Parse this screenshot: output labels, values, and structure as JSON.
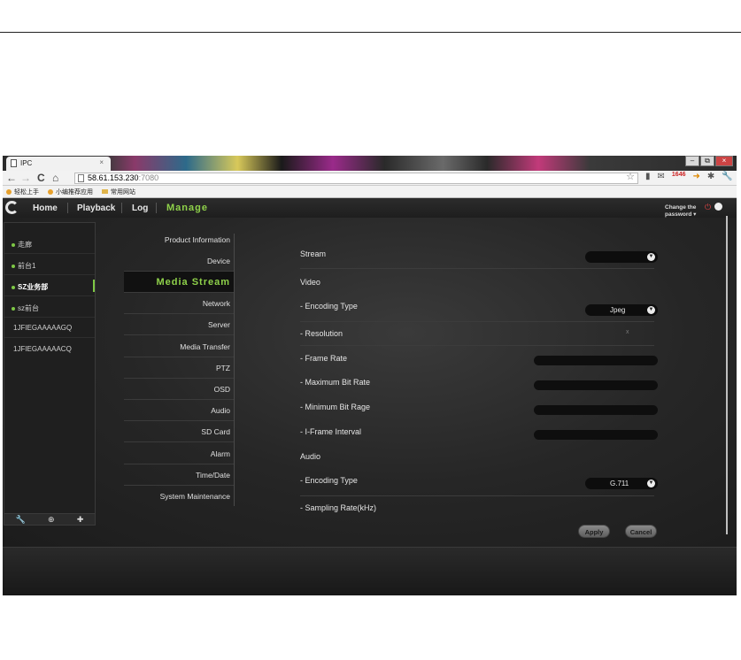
{
  "browser": {
    "tab_title": "IPC",
    "tab_close": "×",
    "url_host": "58.61.153.230",
    "url_port": ":7080",
    "window_controls": [
      "–",
      "⧉",
      "×"
    ],
    "badge": "1646"
  },
  "bookmarks": [
    {
      "label": "轻松上手",
      "icon": "chrome-icon"
    },
    {
      "label": "小编推荐应用",
      "icon": "chrome-icon"
    },
    {
      "label": "常用网站",
      "icon": "folder-icon"
    }
  ],
  "header": {
    "home": "Home",
    "playback": "Playback",
    "log": "Log",
    "manage": "Manage",
    "change_password_1": "Change the",
    "change_password_2": "password ▾"
  },
  "devices": [
    {
      "label": "走廊",
      "dot": true,
      "active": false
    },
    {
      "label": "前台1",
      "dot": true,
      "active": false
    },
    {
      "label": "SZ业务部",
      "dot": true,
      "active": true
    },
    {
      "label": "sz前台",
      "dot": true,
      "active": false
    },
    {
      "label": "1JFIEGAAAAAGQ",
      "dot": false,
      "active": false
    },
    {
      "label": "1JFIEGAAAAACQ",
      "dot": false,
      "active": false
    }
  ],
  "device_tools": [
    "wrench-icon",
    "zoom-icon",
    "add-icon"
  ],
  "menu": [
    "Product Information",
    "Device",
    "Media Stream",
    "Network",
    "Server",
    "Media Transfer",
    "PTZ",
    "OSD",
    "Audio",
    "SD Card",
    "Alarm",
    "Time/Date",
    "System Maintenance"
  ],
  "menu_active": "Media Stream",
  "form": {
    "stream_label": "Stream",
    "stream_value": "",
    "video_label": "Video",
    "encoding_type_label": "- Encoding Type",
    "encoding_type_value": "Jpeg",
    "resolution_label": "- Resolution",
    "resolution_value": "x",
    "frame_rate_label": "- Frame Rate",
    "max_bitrate_label": "- Maximum Bit Rate",
    "min_bitrate_label": "- Minimum Bit Rage",
    "iframe_label": "- I-Frame Interval",
    "audio_label": "Audio",
    "audio_encoding_label": "- Encoding Type",
    "audio_encoding_value": "G.711",
    "sampling_rate_label": "- Sampling Rate(kHz)"
  },
  "buttons": {
    "apply": "Apply",
    "cancel": "Cancel"
  },
  "colors": {
    "accent_green": "#8fd24a",
    "background": "#1c1c1c"
  }
}
